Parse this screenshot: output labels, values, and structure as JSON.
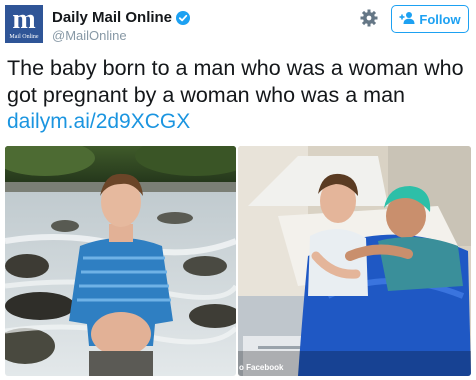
{
  "account": {
    "display_name": "Daily Mail Online",
    "handle": "@MailOnline",
    "logo_letter": "m",
    "logo_text": "Mail Online",
    "verified": true
  },
  "actions": {
    "follow_label": "Follow"
  },
  "tweet": {
    "text": "The baby born to a man who was a woman who got pregnant by a woman who was a man",
    "link": "dailym.ai/2d9XCGX"
  },
  "media": {
    "right_photo_credit": "o Facebook"
  },
  "colors": {
    "accent": "#1da1f2",
    "link": "#1b95e0",
    "logo_bg": "#2f5597",
    "handle": "#8899a6"
  }
}
